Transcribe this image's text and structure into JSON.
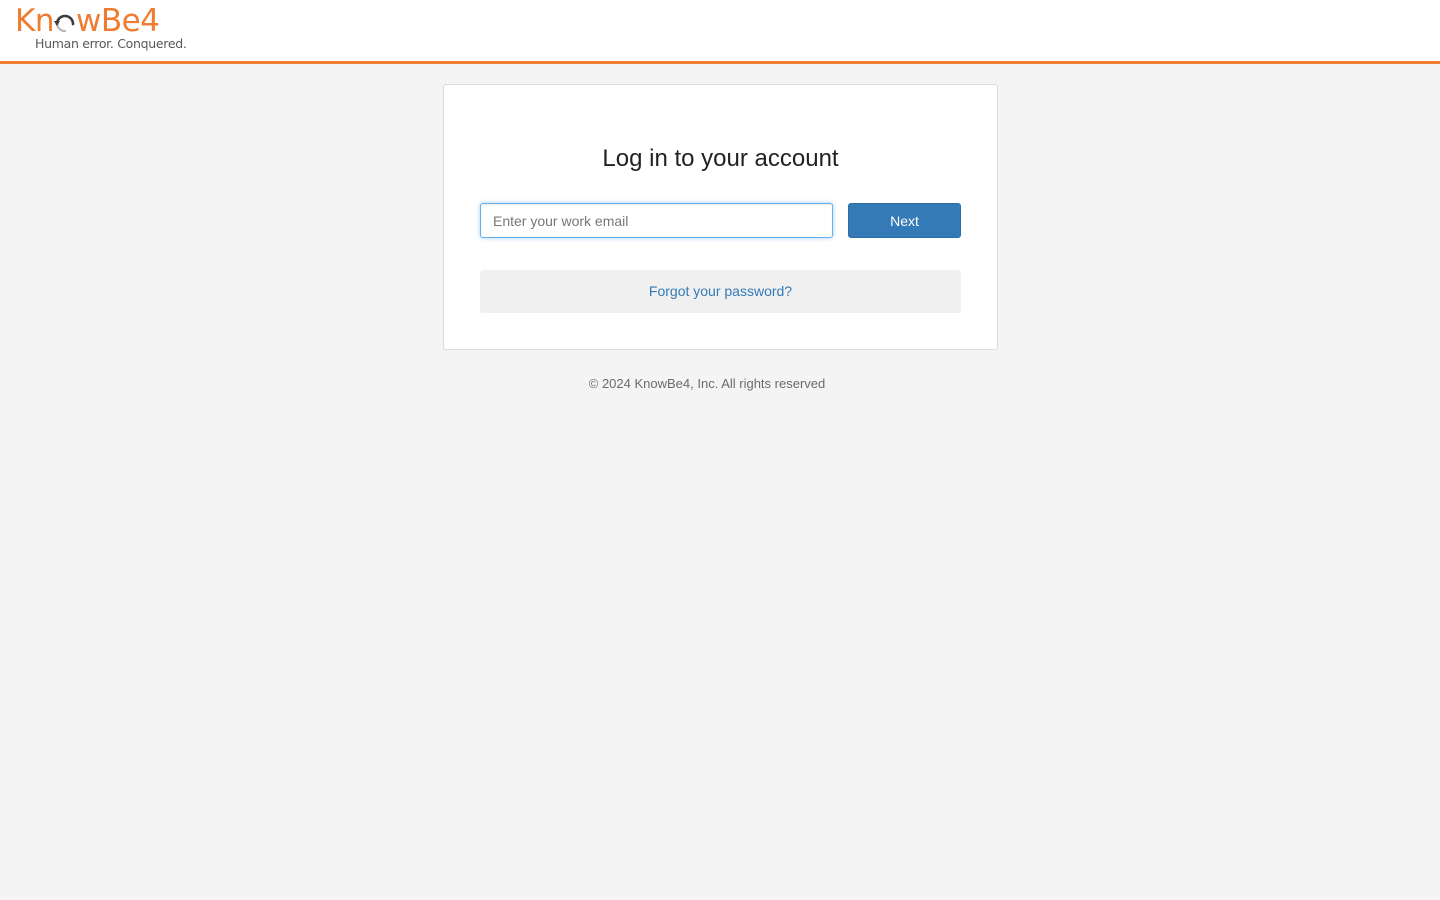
{
  "brand": {
    "name": "KnowBe4",
    "wordmark_prefix": "Kn",
    "wordmark_suffix": "wBe4",
    "tagline": "Human error. Conquered.",
    "accent_color": "#ef7d31"
  },
  "login": {
    "title": "Log in to your account",
    "email_placeholder": "Enter your work email",
    "email_value": "",
    "next_label": "Next",
    "forgot_label": "Forgot your password?"
  },
  "footer": {
    "copyright": "© 2024 KnowBe4, Inc. All rights reserved"
  },
  "colors": {
    "primary_button": "#337ab7",
    "page_background": "#f4f4f4",
    "link": "#337ab7"
  }
}
